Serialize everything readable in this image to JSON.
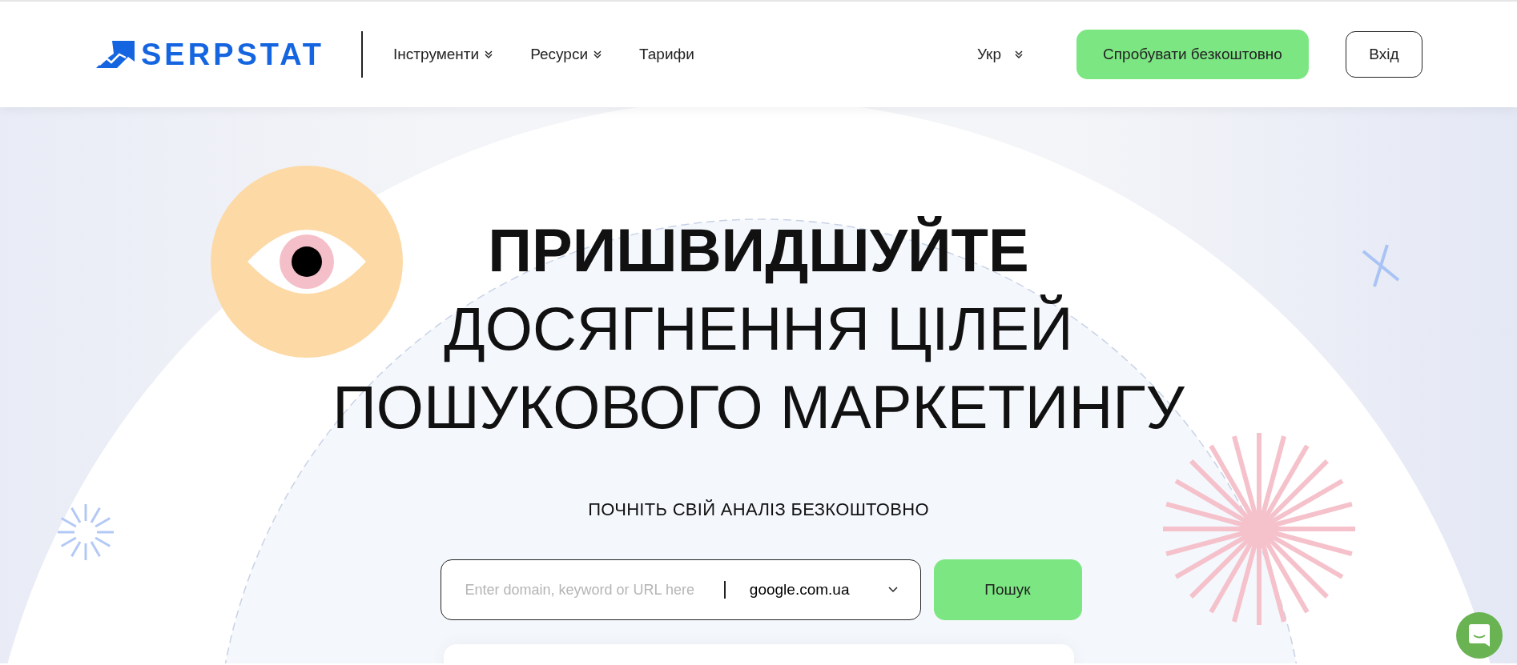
{
  "header": {
    "logo": "SERPSTAT",
    "nav": [
      {
        "label": "Інструменти",
        "dropdown": true
      },
      {
        "label": "Ресурси",
        "dropdown": true
      },
      {
        "label": "Тарифи",
        "dropdown": false
      }
    ],
    "language": "Укр",
    "cta": "Спробувати безкоштовно",
    "login": "Вхід"
  },
  "hero": {
    "title_lines": [
      {
        "text": "ПРИШВИДШУЙТЕ",
        "bold": true
      },
      {
        "text": "ДОСЯГНЕННЯ ЦІЛЕЙ",
        "bold": false
      },
      {
        "text": "ПОШУКОВОГО МАРКЕТИНГУ",
        "bold": false
      }
    ],
    "subtitle": "ПОЧНІТЬ СВІЙ АНАЛІЗ БЕЗКОШТОВНО",
    "search": {
      "placeholder": "Enter domain, keyword or URL here",
      "engine": "google.com.ua",
      "button": "Пошук"
    }
  }
}
